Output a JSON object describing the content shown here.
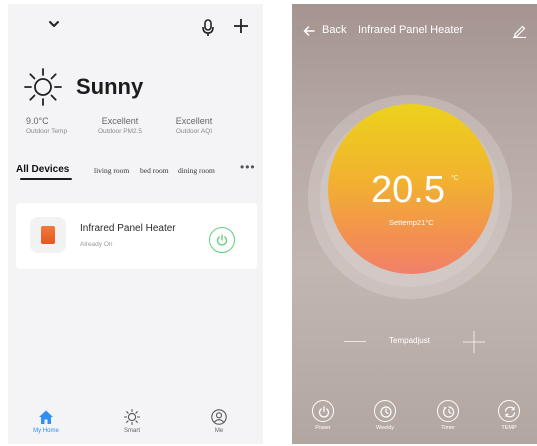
{
  "home": {
    "weather": {
      "condition": "Sunny",
      "temp_value": "9.0°C",
      "temp_label": "Outdoor Temp",
      "pm25_value": "Excellent",
      "pm25_label": "Outdoor PM2.5",
      "aqi_value": "Excellent",
      "aqi_label": "Outdoor AQI"
    },
    "tabs": [
      "All Devices",
      "living room",
      "bed room",
      "dining room"
    ],
    "more_label": "•••",
    "device": {
      "name": "Infrared Panel Heater",
      "status": "Already On"
    },
    "nav": [
      "My Home",
      "Smart",
      "Me"
    ]
  },
  "detail": {
    "back_label": "Back",
    "title": "Infrared Panel Heater",
    "temperature": "20.5",
    "unit": "°C",
    "set_temp": "Settemp21°C",
    "adjust_label": "Tempadjust",
    "controls": [
      "Power",
      "Weekly",
      "Timer",
      "TEMP"
    ]
  },
  "colors": {
    "accent_blue": "#2f8ff2",
    "power_green": "#5fd07a",
    "device_orange": "#e8622a",
    "dial_top": "#ecd21c",
    "dial_bottom": "#f1806a"
  }
}
